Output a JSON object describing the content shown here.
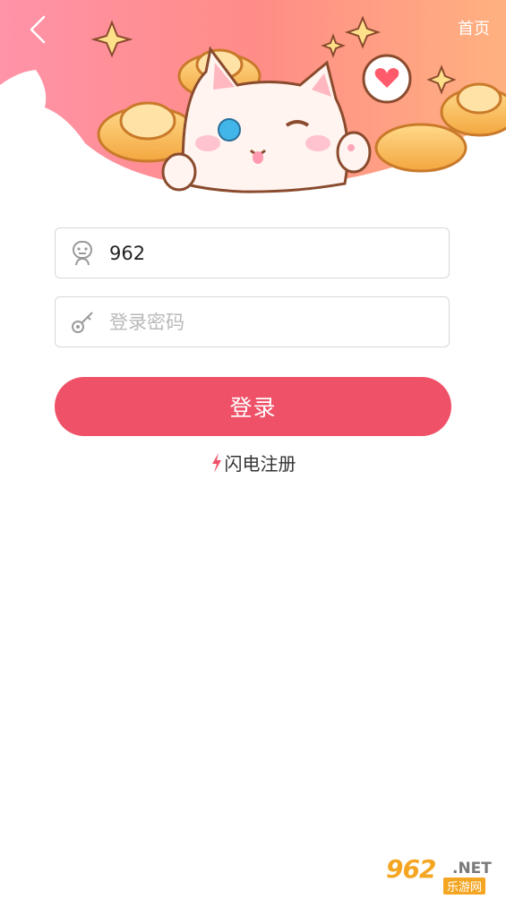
{
  "header": {
    "home_label": "首页",
    "back_icon": "chevron-left-icon",
    "mascot": "cat-with-gold-ingots-illustration"
  },
  "form": {
    "username_value": "962",
    "password_placeholder": "登录密码",
    "login_label": "登录",
    "register_label": "闪电注册"
  },
  "watermark": {
    "number": "962",
    "domain": ".NET",
    "subtitle": "乐游网"
  },
  "colors": {
    "accent": "#ef5168",
    "banner_start": "#ff8fa3",
    "banner_end": "#ffb37a",
    "lightning": "#ef5168"
  }
}
